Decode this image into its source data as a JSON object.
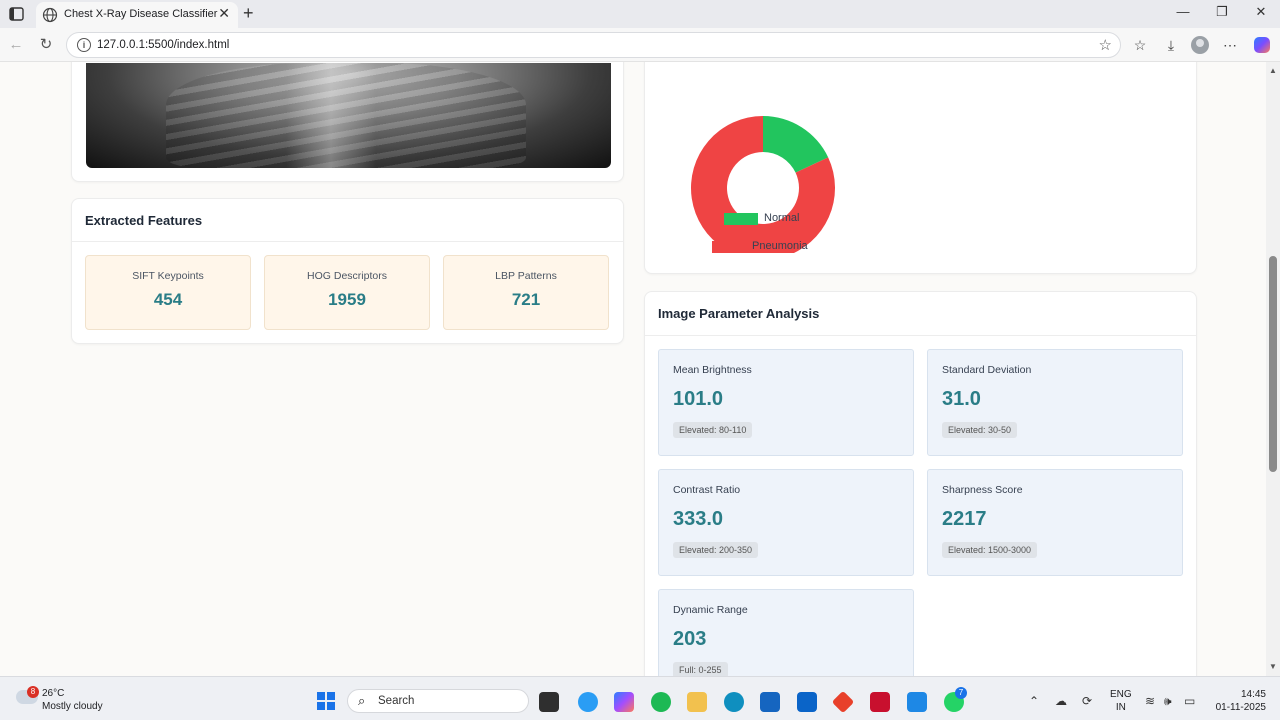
{
  "browser": {
    "tab_title": "Chest X-Ray Disease Classifier",
    "url": "127.0.0.1:5500/index.html"
  },
  "features": {
    "title": "Extracted Features",
    "items": [
      {
        "label": "SIFT Keypoints",
        "value": "454"
      },
      {
        "label": "HOG Descriptors",
        "value": "1959"
      },
      {
        "label": "LBP Patterns",
        "value": "721"
      }
    ]
  },
  "chart_data": {
    "type": "pie",
    "donut": true,
    "categories": [
      "Normal",
      "Pneumonia"
    ],
    "values": [
      18,
      82
    ],
    "colors": [
      "#22c55e",
      "#ef4444"
    ],
    "legend_position": "bottom"
  },
  "params": {
    "title": "Image Parameter Analysis",
    "items": [
      {
        "label": "Mean Brightness",
        "value": "101.0",
        "badge": "Elevated: 80-110"
      },
      {
        "label": "Standard Deviation",
        "value": "31.0",
        "badge": "Elevated: 30-50"
      },
      {
        "label": "Contrast Ratio",
        "value": "333.0",
        "badge": "Elevated: 200-350"
      },
      {
        "label": "Sharpness Score",
        "value": "2217",
        "badge": "Elevated: 1500-3000"
      },
      {
        "label": "Dynamic Range",
        "value": "203",
        "badge": "Full: 0-255"
      }
    ]
  },
  "taskbar": {
    "weather_badge": "8",
    "temperature": "26°C",
    "weather": "Mostly cloudy",
    "search_label": "Search",
    "lang_1": "ENG",
    "lang_2": "IN",
    "time": "14:45",
    "date": "01-11-2025",
    "whatsapp_badge": "7"
  },
  "colors": {
    "accent_value": "#2a7d87",
    "feature_bg": "#fff6ea",
    "param_bg": "#eef3fa"
  }
}
